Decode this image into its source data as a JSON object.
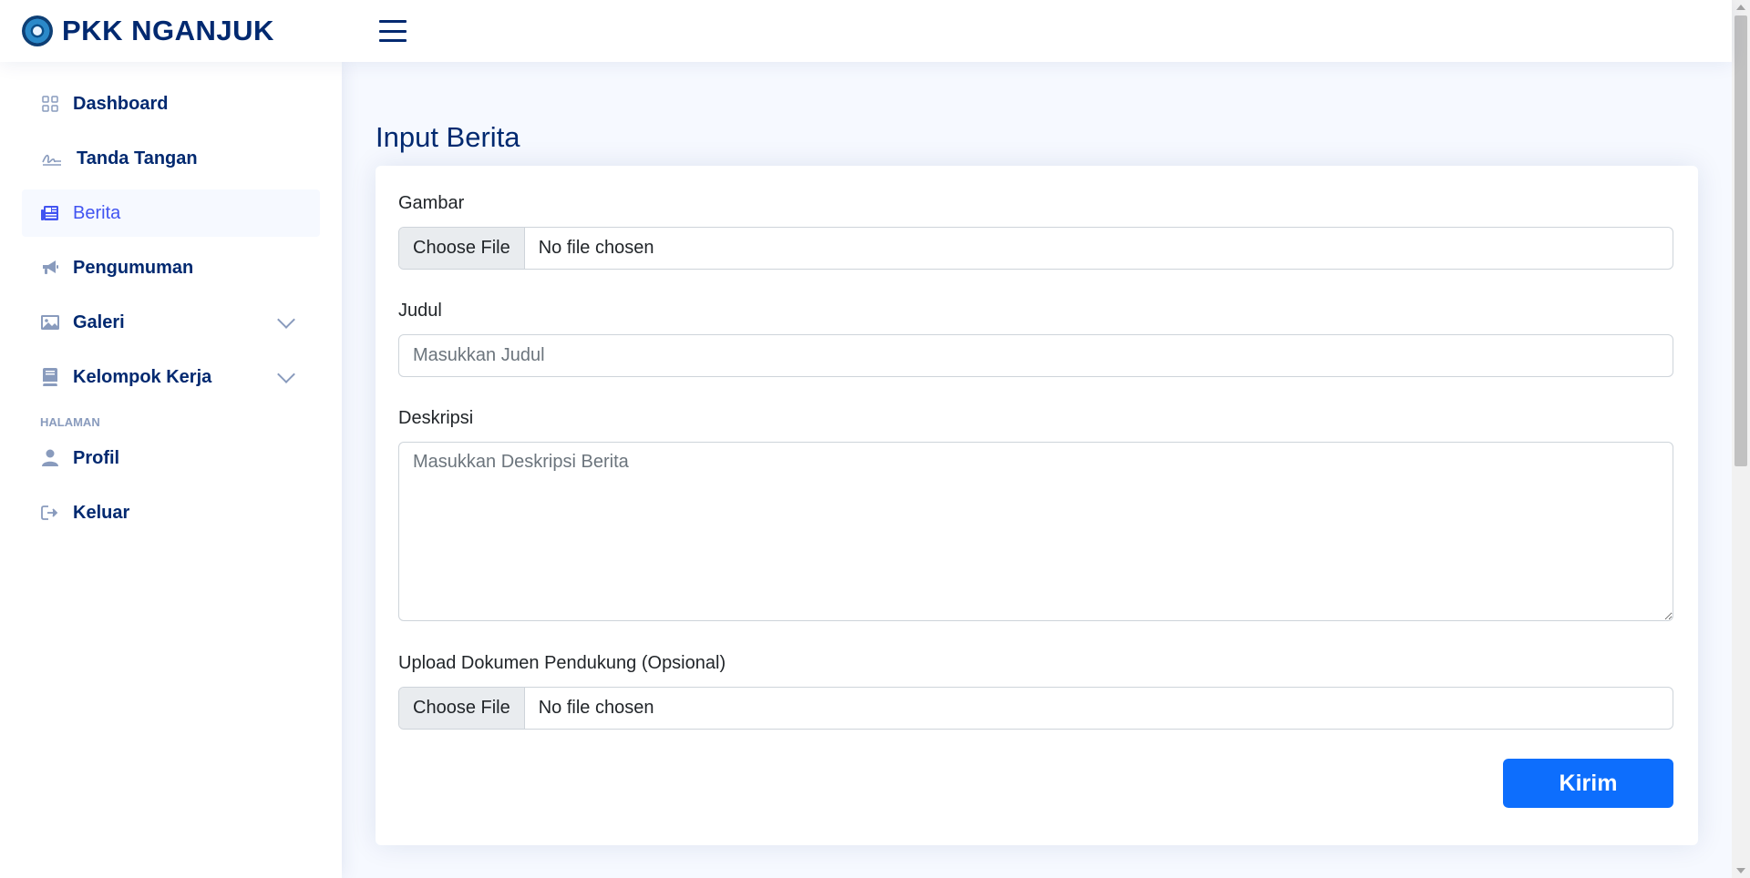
{
  "header": {
    "app_name": "PKK NGANJUK"
  },
  "sidebar": {
    "items": [
      {
        "label": "Dashboard",
        "icon": "grid-icon"
      },
      {
        "label": "Tanda Tangan",
        "icon": "signature-icon"
      },
      {
        "label": "Berita",
        "icon": "newspaper-icon",
        "active": true
      },
      {
        "label": "Pengumuman",
        "icon": "megaphone-icon"
      },
      {
        "label": "Galeri",
        "icon": "image-icon",
        "expandable": true
      },
      {
        "label": "Kelompok Kerja",
        "icon": "book-icon",
        "expandable": true
      }
    ],
    "heading": "HALAMAN",
    "page_items": [
      {
        "label": "Profil",
        "icon": "person-icon"
      },
      {
        "label": "Keluar",
        "icon": "logout-icon"
      }
    ]
  },
  "main": {
    "title": "Input Berita",
    "form": {
      "gambar_label": "Gambar",
      "gambar_button": "Choose File",
      "gambar_status": "No file chosen",
      "judul_label": "Judul",
      "judul_placeholder": "Masukkan Judul",
      "deskripsi_label": "Deskripsi",
      "deskripsi_placeholder": "Masukkan Deskripsi Berita",
      "dokumen_label": "Upload Dokumen Pendukung (Opsional)",
      "dokumen_button": "Choose File",
      "dokumen_status": "No file chosen",
      "submit_label": "Kirim"
    }
  },
  "colors": {
    "primary": "#0d6efd",
    "brand": "#012970",
    "active": "#4154f1",
    "background": "#f6f9ff"
  }
}
